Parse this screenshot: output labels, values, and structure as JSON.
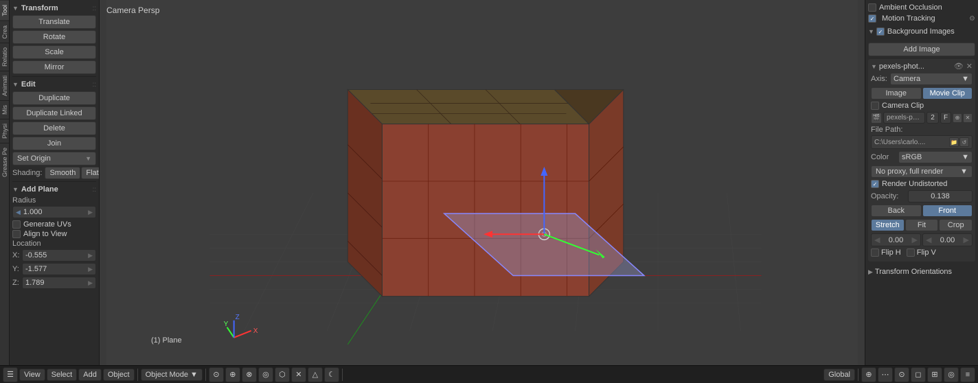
{
  "leftPanel": {
    "sideTabs": [
      "Crea",
      "Tool",
      "Relatio",
      "Animati",
      "Mis",
      "Physi",
      "Grease Pe"
    ],
    "transformSection": {
      "title": "Transform",
      "buttons": [
        "Translate",
        "Rotate",
        "Scale",
        "Mirror"
      ]
    },
    "editSection": {
      "title": "Edit",
      "buttons": [
        "Duplicate",
        "Duplicate Linked",
        "Delete",
        "Join"
      ],
      "setOriginLabel": "Set Origin",
      "shading": {
        "label": "Shading:",
        "smooth": "Smooth",
        "flat": "Flat"
      }
    },
    "addPlaneSection": {
      "title": "Add Plane",
      "radiusLabel": "Radius",
      "radiusValue": "1.000",
      "generateUVsLabel": "Generate UVs",
      "alignToViewLabel": "Align to View",
      "locationLabel": "Location",
      "xLabel": "X:",
      "xValue": "-0.555",
      "yLabel": "Y:",
      "yValue": "-1.577",
      "zLabel": "Z:",
      "zValue": "1.789"
    }
  },
  "viewport": {
    "title": "Camera Persp",
    "planeLabel": "(1) Plane"
  },
  "rightPanel": {
    "ambientOcclusion": {
      "label": "Ambient Occlusion"
    },
    "motionTracking": {
      "label": "Motion Tracking",
      "checked": true
    },
    "backgroundImages": {
      "label": "Background Images",
      "addImageLabel": "Add Image",
      "imageEntry": {
        "name": "pexels-phot...",
        "axisLabel": "Axis:",
        "axisValue": "Camera",
        "imageTabLabel": "Image",
        "movieClipTabLabel": "Movie Clip",
        "cameraClipLabel": "Camera Clip",
        "fileNum": "2",
        "fileLetter": "F",
        "filePathLabel": "File Path:",
        "filePath": "C:\\Users\\carlo....",
        "colorLabel": "Color",
        "colorValue": "sRGB",
        "proxyLabel": "No proxy, full render",
        "renderUndistorted": "Render Undistorted",
        "opacityLabel": "Opacity:",
        "opacityValue": "0.138",
        "backLabel": "Back",
        "frontLabel": "Front",
        "stretchLabel": "Stretch",
        "fitLabel": "Fit",
        "cropLabel": "Crop",
        "offsetXValue": "0.00",
        "offsetYValue": "0.00",
        "flipHLabel": "Flip H",
        "flipVLabel": "Flip V"
      }
    },
    "transformOrientations": {
      "label": "Transform Orientations"
    }
  },
  "bottomBar": {
    "menuItems": [
      "☰",
      "View",
      "Select",
      "Add",
      "Object"
    ],
    "mode": "Object Mode",
    "globalLabel": "Global",
    "icons": [
      "⊙",
      "⊕",
      "⊗",
      "◎",
      "⬡",
      "✕",
      "△",
      "☾",
      "⬡"
    ],
    "rightIcons": [
      "⊕",
      "⋯",
      "⊙",
      "◻",
      "⊞",
      "◎",
      "≡"
    ]
  }
}
